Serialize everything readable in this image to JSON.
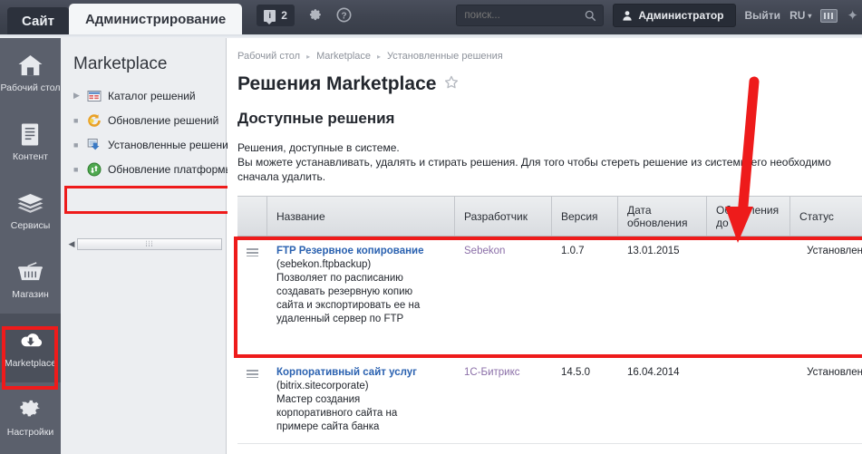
{
  "header": {
    "tab_site": "Сайт",
    "tab_admin": "Администрирование",
    "notifications_count": "2",
    "notification_icon": "info-icon",
    "gear_icon": "gear-icon",
    "help_icon": "help-icon",
    "search_placeholder": "поиск...",
    "search_value": "",
    "search_icon": "search-icon",
    "user_name": "Администратор",
    "user_icon": "user-icon",
    "logout_label": "Выйти",
    "language": "RU",
    "keyboard_icon": "keyboard-icon",
    "pin_icon": "pin-icon"
  },
  "rail": {
    "items": [
      {
        "label": "Рабочий стол",
        "icon": "home-icon",
        "active": false
      },
      {
        "label": "Контент",
        "icon": "document-icon",
        "active": false
      },
      {
        "label": "Сервисы",
        "icon": "layers-icon",
        "active": false
      },
      {
        "label": "Магазин",
        "icon": "basket-icon",
        "active": false
      },
      {
        "label": "Marketplace",
        "icon": "cloud-download-icon",
        "active": true
      },
      {
        "label": "Настройки",
        "icon": "gear-icon",
        "active": false
      }
    ]
  },
  "panel": {
    "title": "Marketplace",
    "items": [
      {
        "label": "Каталог решений",
        "icon": "catalog-icon",
        "bullet": "triangle"
      },
      {
        "label": "Обновление решений",
        "icon": "refresh-icon",
        "bullet": "dot"
      },
      {
        "label": "Установленные решения",
        "icon": "install-icon",
        "bullet": "dot"
      },
      {
        "label": "Обновление платформы",
        "icon": "update-icon",
        "bullet": "dot"
      }
    ],
    "scroll_left_icon": "scroll-left-arrow-icon",
    "scroll_grip": "⦙⦙⦙"
  },
  "content": {
    "breadcrumbs": [
      "Рабочий стол",
      "Marketplace",
      "Установленные решения"
    ],
    "breadcrumb_separator": "▸",
    "page_title": "Решения Marketplace",
    "favorite_icon": "star-icon",
    "section_title": "Доступные решения",
    "description_line1": "Решения, доступные в системе.",
    "description_line2": "Вы можете устанавливать, удалять и стирать решения. Для того чтобы стереть решение из системы его необходимо",
    "description_line3": "сначала удалить."
  },
  "table": {
    "columns": [
      "",
      "Название",
      "Разработчик",
      "Версия",
      "Дата обновления",
      "Обновления до",
      "Статус"
    ],
    "rows": [
      {
        "grip_icon": "drag-handle-icon",
        "name": "FTP Резервное копирование",
        "code": "(sebekon.ftpbackup)",
        "description": "Позволяет по расписанию создавать резервную копию сайта и экспортировать ее на удаленный сервер по FTP",
        "developer": "Sebekon",
        "version": "1.0.7",
        "update_date": "13.01.2015",
        "updates_until": "",
        "status": "Установлен"
      },
      {
        "grip_icon": "drag-handle-icon",
        "name": "Корпоративный сайт услуг",
        "code": "(bitrix.sitecorporate)",
        "description": "Мастер создания корпоративного сайта на примере сайта банка",
        "developer": "1С-Битрикс",
        "version": "14.5.0",
        "update_date": "16.04.2014",
        "updates_until": "",
        "status": "Установлен"
      }
    ]
  },
  "annotations": {
    "highlight_color": "#ee1b1b",
    "arrow_color": "#ee1b1b",
    "highlight_rail_item": "Marketplace",
    "highlight_panel_item": "Установленные решения",
    "highlight_table_row": "FTP Резервное копирование"
  }
}
